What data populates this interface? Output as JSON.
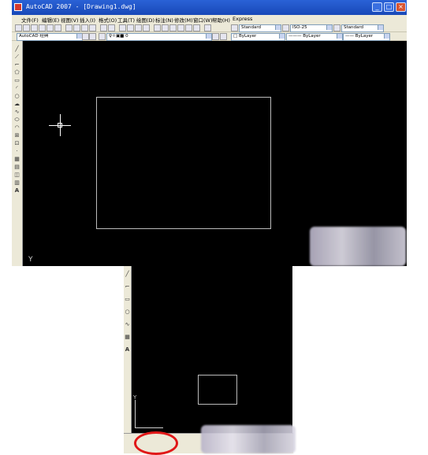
{
  "window": {
    "title": "AutoCAD 2007 - [Drawing1.dwg]",
    "controls": [
      "_",
      "□",
      "×"
    ]
  },
  "menu": {
    "items": [
      "文件(F)",
      "编辑(E)",
      "视图(V)",
      "插入(I)",
      "格式(O)",
      "工具(T)",
      "绘图(D)",
      "标注(N)",
      "修改(M)",
      "窗口(W)",
      "帮助(H)",
      "Express"
    ]
  },
  "toolbar_styles": {
    "text_style": "Standard",
    "dim_style": "ISO-25",
    "table_style": "Standard"
  },
  "toolbar_layers": {
    "workspace": "AutoCAD 经典",
    "layer": "0",
    "color": "ByLayer",
    "linetype": "ByLayer",
    "lineweight": "ByLayer"
  },
  "canvas": {
    "axis_label": "Y",
    "second_axis_label": "Y"
  },
  "colors": {
    "title_bar": "#1848b8",
    "canvas": "#000000",
    "chrome": "#ece9d8",
    "highlight_ring": "#e01818"
  },
  "icons": [
    "line-icon",
    "polyline-icon",
    "polygon-icon",
    "rectangle-icon",
    "arc-icon",
    "circle-icon",
    "spline-icon",
    "ellipse-icon",
    "hatch-icon",
    "text-icon"
  ]
}
